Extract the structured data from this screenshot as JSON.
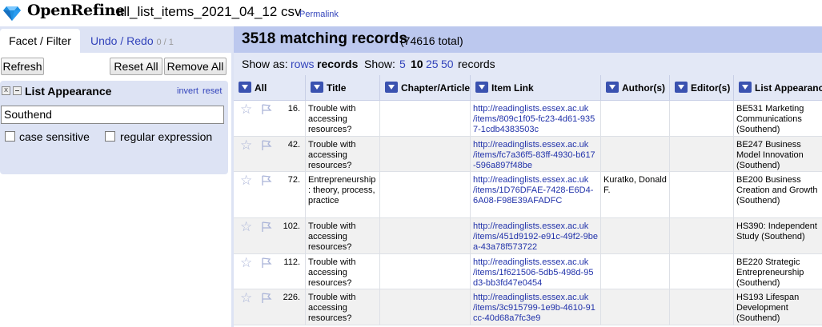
{
  "header": {
    "logo": "OpenRefine",
    "project_name": "all_list_items_2021_04_12 csv",
    "permalink": "Permalink"
  },
  "left": {
    "tabs": {
      "facet_filter": "Facet / Filter",
      "undo_redo": "Undo / Redo",
      "undo_count": "0 / 1"
    },
    "buttons": {
      "refresh": "Refresh",
      "reset_all": "Reset All",
      "remove_all": "Remove All"
    },
    "facet": {
      "title": "List Appearance",
      "invert": "invert",
      "reset": "reset",
      "close": "x",
      "query": "Southend",
      "case_sensitive": "case sensitive",
      "regular_expression": "regular expression"
    }
  },
  "summary": {
    "count": "3518 matching records",
    "total": "(74616 total)"
  },
  "view_bar": {
    "show_as": "Show as:",
    "rows": "rows",
    "records": "records",
    "show": "Show:",
    "opt5": "5",
    "opt10": "10",
    "opt25": "25",
    "opt50": "50",
    "records_label": "records"
  },
  "columns": {
    "all": "All",
    "title": "Title",
    "chapter": "Chapter/Article",
    "item_link": "Item Link",
    "authors": "Author(s)",
    "editors": "Editor(s)",
    "list_appearance": "List Appearance"
  },
  "rows": [
    {
      "num": "16.",
      "title": "Trouble with accessing resources?",
      "link": "http://readinglists.essex.ac.uk/items/809c1f05-fc23-4d61-9357-1cdb4383503c",
      "authors": "",
      "list": "BE531 Marketing Communications (Southend)"
    },
    {
      "num": "42.",
      "title": "Trouble with accessing resources?",
      "link": "http://readinglists.essex.ac.uk/items/fc7a36f5-83ff-4930-b617-596a897f48be",
      "authors": "",
      "list": "BE247 Business Model Innovation (Southend)"
    },
    {
      "num": "72.",
      "title": "Entrepreneurship : theory, process, practice",
      "link": "http://readinglists.essex.ac.uk/items/1D76DFAE-7428-E6D4-6A08-F98E39AFADFC",
      "authors": "Kuratko, Donald F.",
      "list": "BE200 Business Creation and Growth (Southend)"
    },
    {
      "num": "102.",
      "title": "Trouble with accessing resources?",
      "link": "http://readinglists.essex.ac.uk/items/451d9192-e91c-49f2-9bea-43a78f573722",
      "authors": "",
      "list": "HS390: Independent Study (Southend)"
    },
    {
      "num": "112.",
      "title": "Trouble with accessing resources?",
      "link": "http://readinglists.essex.ac.uk/items/1f621506-5db5-498d-95d3-bb3fd47e0454",
      "authors": "",
      "list": "BE220 Strategic Entrepreneurship (Southend)"
    },
    {
      "num": "226.",
      "title": "Trouble with accessing resources?",
      "link": "http://readinglists.essex.ac.uk/items/3c915799-1e9b-4610-91cc-40d68a7fc3e9",
      "authors": "",
      "list": "HS193 Lifespan Development (Southend)"
    }
  ]
}
